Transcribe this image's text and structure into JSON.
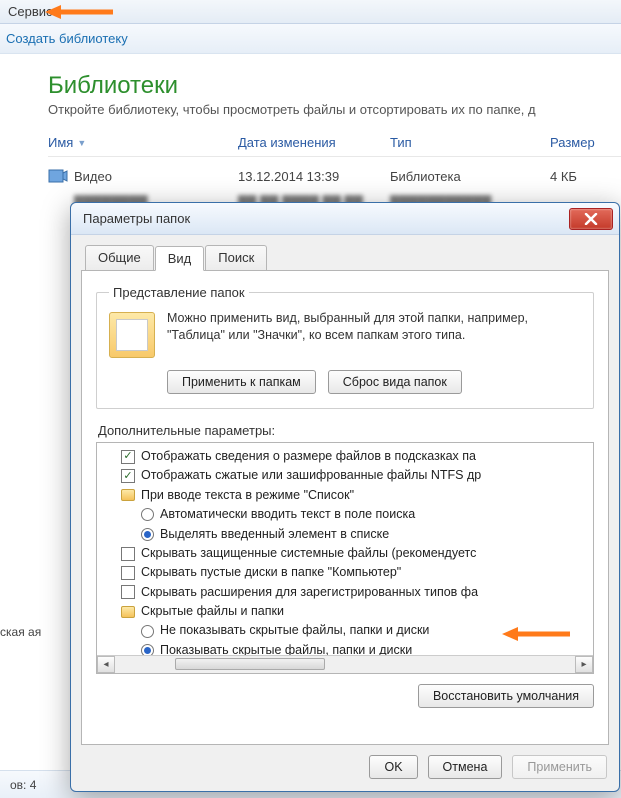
{
  "explorer": {
    "menu_item": "Сервис",
    "toolbar_link": "Создать библиотеку",
    "title": "Библиотеки",
    "subtitle": "Откройте библиотеку, чтобы просмотреть файлы и отсортировать их по папке, д",
    "columns": {
      "name": "Имя",
      "date": "Дата изменения",
      "type": "Тип",
      "size": "Размер"
    },
    "row0": {
      "name": "Видео",
      "date": "13.12.2014 13:39",
      "type": "Библиотека",
      "size": "4 КБ"
    },
    "sidebar_item": "ская ая",
    "status": "ов: 4"
  },
  "dialog": {
    "title": "Параметры папок",
    "tabs": {
      "general": "Общие",
      "view": "Вид",
      "search": "Поиск"
    },
    "group": {
      "legend": "Представление папок",
      "text": "Можно применить вид, выбранный для этой папки, например, \"Таблица\" или \"Значки\", ко всем папкам этого типа.",
      "apply": "Применить к папкам",
      "reset": "Сброс вида папок"
    },
    "adv_label": "Дополнительные параметры:",
    "tree": {
      "i0": "Отображать сведения о размере файлов в подсказках па",
      "i1": "Отображать сжатые или зашифрованные файлы NTFS др",
      "i2": "При вводе текста в режиме \"Список\"",
      "i3": "Автоматически вводить текст в поле поиска",
      "i4": "Выделять введенный элемент в списке",
      "i5": "Скрывать защищенные системные файлы (рекомендуетс",
      "i6": "Скрывать пустые диски в папке \"Компьютер\"",
      "i7": "Скрывать расширения для зарегистрированных типов фа",
      "i8": "Скрытые файлы и папки",
      "i9": "Не показывать скрытые файлы, папки и диски",
      "i10": "Показывать скрытые файлы, папки и диски"
    },
    "restore": "Восстановить умолчания",
    "ok": "OK",
    "cancel": "Отмена",
    "apply": "Применить"
  }
}
